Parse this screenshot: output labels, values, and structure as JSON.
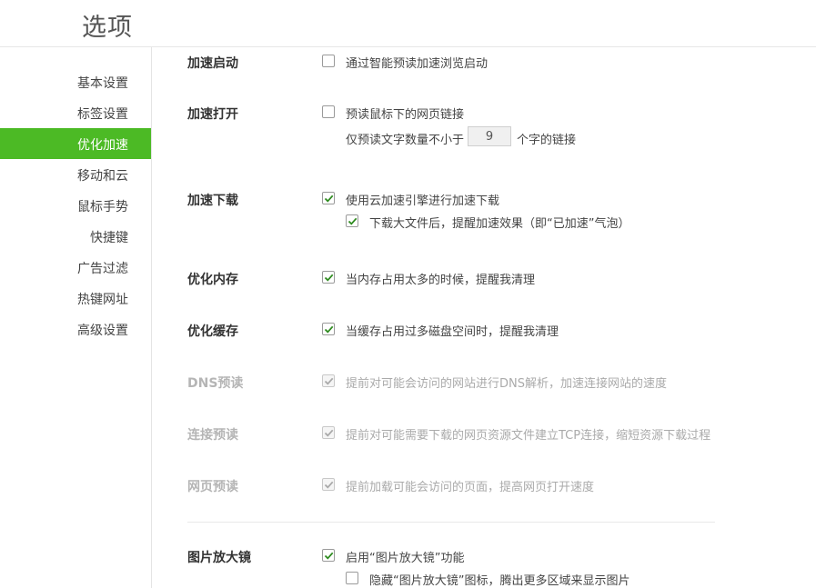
{
  "page": {
    "title": "选项"
  },
  "sidebar": {
    "items": [
      {
        "label": "基本设置"
      },
      {
        "label": "标签设置"
      },
      {
        "label": "优化加速",
        "active": true
      },
      {
        "label": "移动和云"
      },
      {
        "label": "鼠标手势"
      },
      {
        "label": "快捷键"
      },
      {
        "label": "广告过滤"
      },
      {
        "label": "热键网址"
      },
      {
        "label": "高级设置"
      }
    ],
    "active_color": "#4cba25"
  },
  "sections": {
    "accel_start": {
      "label": "加速启动",
      "option": "通过智能预读加速浏览启动",
      "checked": false
    },
    "accel_open": {
      "label": "加速打开",
      "prefetch_link": {
        "label": "预读鼠标下的网页链接",
        "checked": false
      },
      "min_chars_prefix": "仅预读文字数量不小于",
      "min_chars_value": "9",
      "min_chars_suffix": "个字的链接"
    },
    "accel_download": {
      "label": "加速下载",
      "cloud_accel": {
        "label": "使用云加速引擎进行加速下载",
        "checked": true
      },
      "big_file_notice": {
        "label": "下载大文件后，提醒加速效果（即“已加速”气泡）",
        "checked": true
      }
    },
    "optimize_memory": {
      "label": "优化内存",
      "option": {
        "label": "当内存占用太多的时候，提醒我清理",
        "checked": true
      }
    },
    "optimize_cache": {
      "label": "优化缓存",
      "option": {
        "label": "当缓存占用过多磁盘空间时，提醒我清理",
        "checked": true
      }
    },
    "dns_prefetch": {
      "label": "DNS预读",
      "option": {
        "label": "提前对可能会访问的网站进行DNS解析，加速连接网站的速度",
        "checked": true,
        "disabled": true
      }
    },
    "conn_prefetch": {
      "label": "连接预读",
      "option": {
        "label": "提前对可能需要下载的网页资源文件建立TCP连接，缩短资源下载过程",
        "checked": true,
        "disabled": true
      }
    },
    "page_prefetch": {
      "label": "网页预读",
      "option": {
        "label": "提前加载可能会访问的页面，提高网页打开速度",
        "checked": true,
        "disabled": true
      }
    },
    "image_magnifier": {
      "label": "图片放大镜",
      "enable": {
        "label": "启用“图片放大镜”功能",
        "checked": true
      },
      "hide_icon": {
        "label": "隐藏“图片放大镜”图标，腾出更多区域来显示图片",
        "checked": false
      }
    }
  },
  "colors": {
    "check": "#2e8b1f",
    "active_nav": "#4cba25"
  }
}
